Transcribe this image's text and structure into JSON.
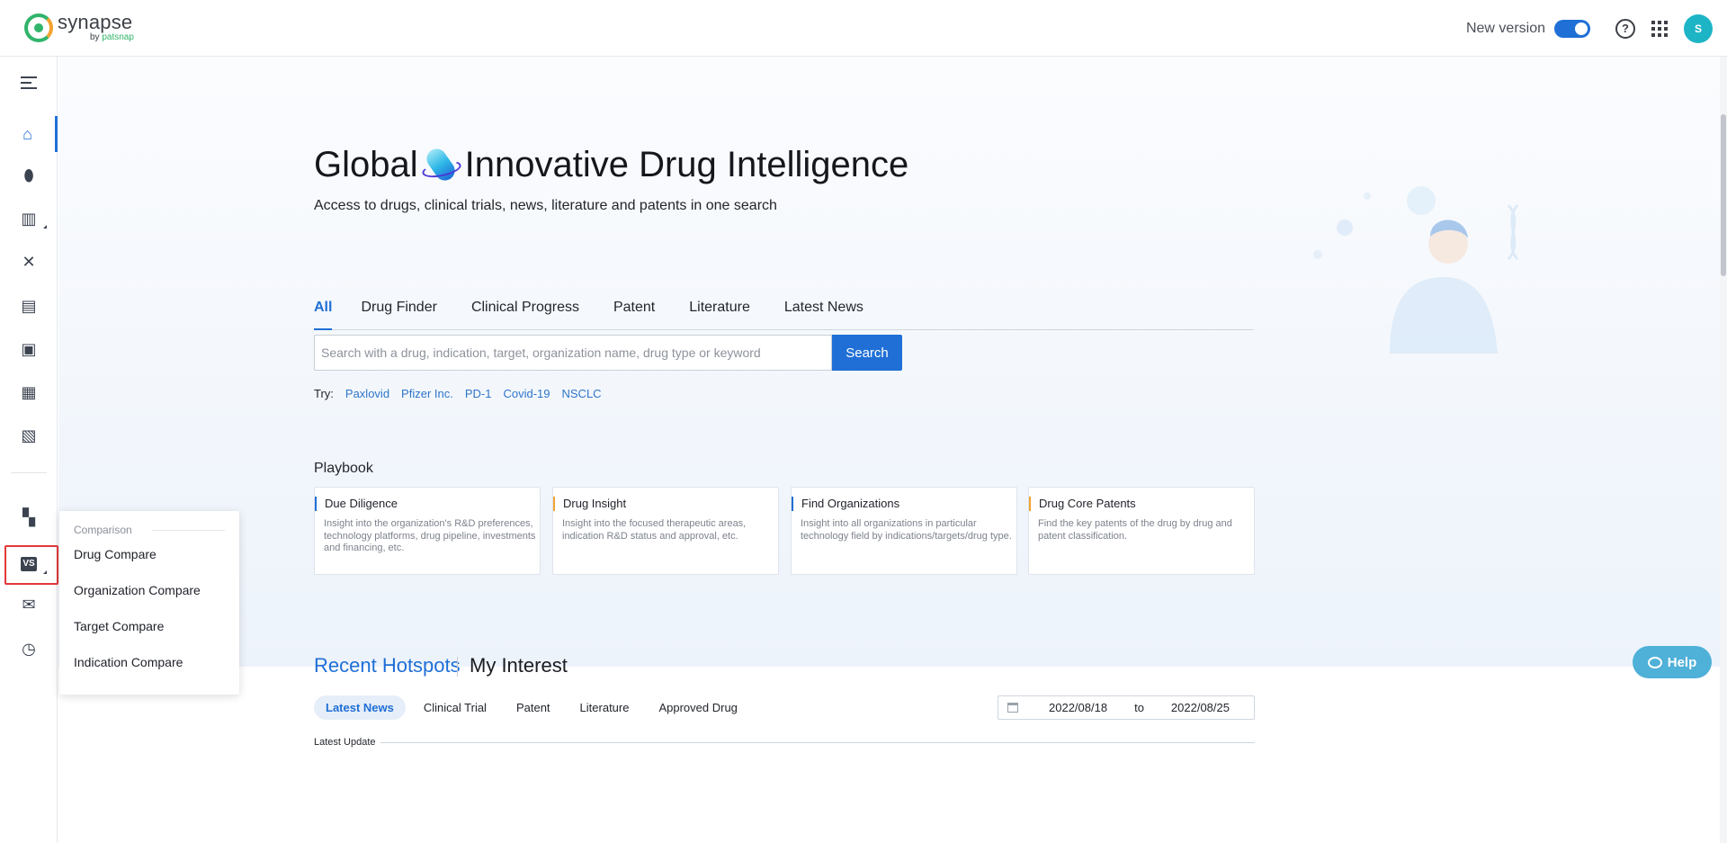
{
  "app": {
    "logo_name": "synapse",
    "logo_by": "by",
    "logo_brand": "patsnap",
    "new_version_label": "New version",
    "new_version_enabled": true,
    "help_icon_label": "?",
    "avatar_initial": "S",
    "accent_color": "#1f6fd6"
  },
  "sidebar": {
    "items": [
      {
        "name": "menu-toggle",
        "icon": "menu-collapse-icon"
      },
      {
        "name": "home",
        "icon": "home-icon",
        "active": true
      },
      {
        "name": "drug",
        "icon": "pill-icon"
      },
      {
        "name": "organization",
        "icon": "organization-icon",
        "has_submenu": true
      },
      {
        "name": "target",
        "icon": "target-icon"
      },
      {
        "name": "clinical",
        "icon": "clinical-report-icon"
      },
      {
        "name": "news",
        "icon": "news-card-icon"
      },
      {
        "name": "literature",
        "icon": "document-icon"
      },
      {
        "name": "patent",
        "icon": "newspaper-icon"
      },
      {
        "name": "dashboard",
        "icon": "dashboard-icon"
      },
      {
        "name": "comparison",
        "icon": "comparison-icon",
        "has_submenu": true,
        "highlighted": true
      },
      {
        "name": "workspace",
        "icon": "mail-upload-icon"
      },
      {
        "name": "history",
        "icon": "history-icon"
      }
    ],
    "comparison_glyph": "VS"
  },
  "dropdown": {
    "title": "Comparison",
    "items": [
      "Drug Compare",
      "Organization Compare",
      "Target Compare",
      "Indication Compare"
    ]
  },
  "hero": {
    "title_left": "Global",
    "title_right": "Innovative Drug Intelligence",
    "subtitle": "Access to drugs, clinical trials, news, literature and patents in one search",
    "tabs": [
      "All",
      "Drug Finder",
      "Clinical Progress",
      "Patent",
      "Literature",
      "Latest News"
    ],
    "active_tab": 0,
    "search_placeholder": "Search with a drug, indication, target, organization name, drug type or keyword",
    "search_button": "Search",
    "try_label": "Try:",
    "try_links": [
      "Paxlovid",
      "Pfizer Inc.",
      "PD-1",
      "Covid-19",
      "NSCLC"
    ]
  },
  "playbook": {
    "title": "Playbook",
    "cards": [
      {
        "title": "Due Diligence",
        "desc": "Insight into the organization's R&D preferences, technology platforms, drug pipeline, investments and financing, etc.",
        "accent": "blue"
      },
      {
        "title": "Drug Insight",
        "desc": "Insight into the focused therapeutic areas, indication R&D status and approval, etc.",
        "accent": "orange"
      },
      {
        "title": "Find Organizations",
        "desc": "Insight into all organizations in particular technology field by indications/targets/drug type.",
        "accent": "blue"
      },
      {
        "title": "Drug Core Patents",
        "desc": "Find the key patents of the drug by drug and patent classification.",
        "accent": "orange"
      }
    ]
  },
  "hotspots": {
    "title": "Recent Hotspots",
    "title2": "My Interest",
    "subtabs": [
      "Latest News",
      "Clinical Trial",
      "Patent",
      "Literature",
      "Approved Drug"
    ],
    "active_subtab": 0,
    "date_from": "2022/08/18",
    "date_to_label": "to",
    "date_to": "2022/08/25",
    "latest_update": "Latest Update"
  },
  "help_button": "Help"
}
